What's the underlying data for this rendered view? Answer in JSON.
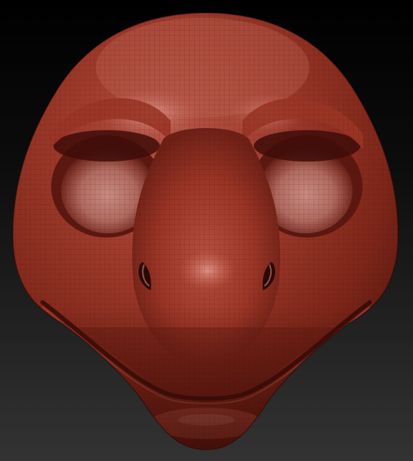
{
  "scene": {
    "subject": "sculpt-head-front-view",
    "material_color": "#9a3526",
    "material_highlight": "#d98a7c",
    "material_shadow": "#4a120c",
    "background_top": "#000000",
    "background_bottom": "#333333"
  }
}
